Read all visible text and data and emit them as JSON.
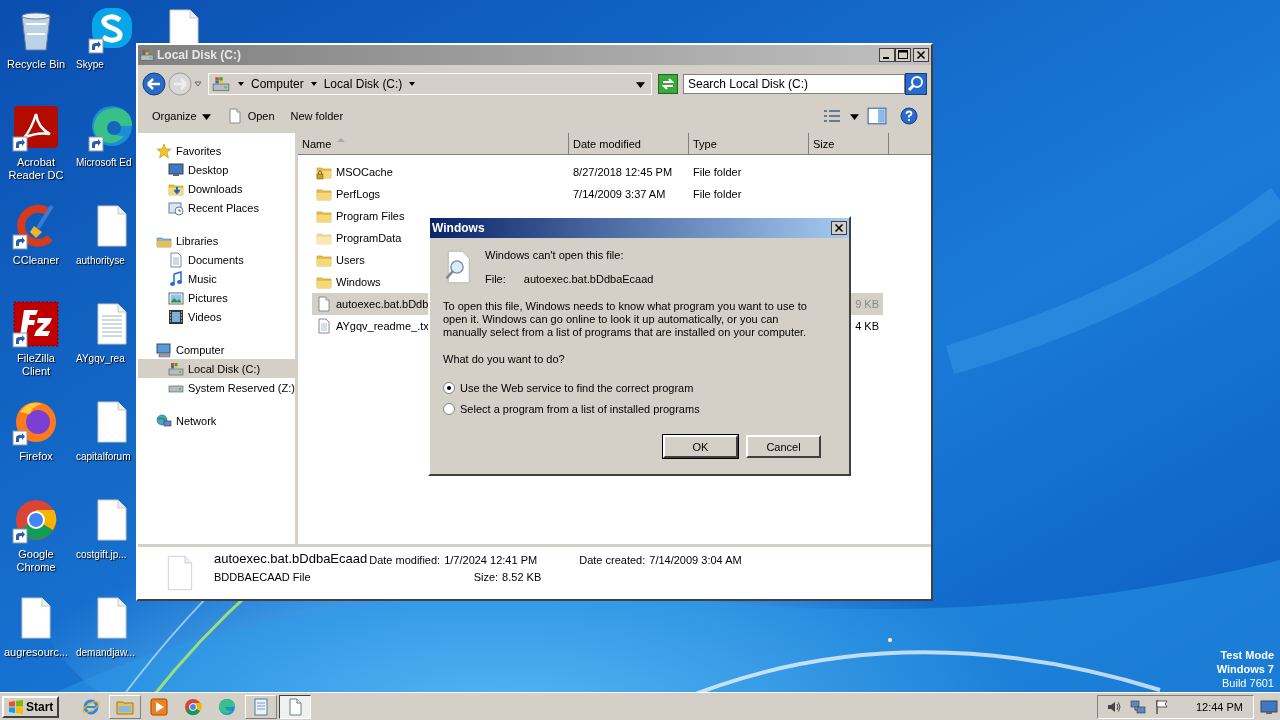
{
  "desktop_icons": [
    {
      "kind": "recycle",
      "label": "Recycle Bin",
      "shortcut": false
    },
    {
      "kind": "acrobat",
      "label": "Acrobat Reader DC",
      "shortcut": true
    },
    {
      "kind": "ccleaner",
      "label": "CCleaner",
      "shortcut": true
    },
    {
      "kind": "filezilla",
      "label": "FileZilla Client",
      "shortcut": true
    },
    {
      "kind": "firefox",
      "label": "Firefox",
      "shortcut": true
    },
    {
      "kind": "chrome",
      "label": "Google Chrome",
      "shortcut": true
    },
    {
      "kind": "file",
      "label": "augresourc...",
      "shortcut": false
    },
    {
      "kind": "skype",
      "label": "Skype",
      "shortcut": true
    },
    {
      "kind": "edge",
      "label": "Microsoft Ed",
      "shortcut": true
    },
    {
      "kind": "file",
      "label": "authorityse",
      "shortcut": false
    },
    {
      "kind": "textfile",
      "label": "AYgqv_rea",
      "shortcut": false
    },
    {
      "kind": "file",
      "label": "capitalforum",
      "shortcut": false
    },
    {
      "kind": "file",
      "label": "costgift.jp...",
      "shortcut": false
    },
    {
      "kind": "file",
      "label": "demandjaw...",
      "shortcut": false
    },
    {
      "kind": "file",
      "shortcut": false
    }
  ],
  "explorer": {
    "title": "Local Disk (C:)",
    "breadcrumb": [
      "Computer",
      "Local Disk (C:)"
    ],
    "search": {
      "placeholder": "Search Local Disk (C:)"
    },
    "toolbar": [
      {
        "kind": "menu",
        "label": "Organize"
      },
      {
        "kind": "open",
        "label": "Open"
      },
      {
        "kind": "plain",
        "label": "New folder"
      }
    ],
    "nav": [
      {
        "kind": "favorites",
        "label": "Favorites",
        "selected": false,
        "children": [
          {
            "kind": "desktop",
            "label": "Desktop",
            "selected": false
          },
          {
            "kind": "downloads",
            "label": "Downloads",
            "selected": false
          },
          {
            "kind": "recent",
            "label": "Recent Places",
            "selected": false
          }
        ]
      },
      {
        "kind": "libraries",
        "label": "Libraries",
        "selected": false,
        "children": [
          {
            "kind": "documents",
            "label": "Documents",
            "selected": false
          },
          {
            "kind": "music",
            "label": "Music",
            "selected": false
          },
          {
            "kind": "pictures",
            "label": "Pictures",
            "selected": false
          },
          {
            "kind": "videos",
            "label": "Videos",
            "selected": false
          }
        ]
      },
      {
        "kind": "computer",
        "label": "Computer",
        "selected": false,
        "children": [
          {
            "kind": "drive",
            "label": "Local Disk (C:)",
            "selected": true
          },
          {
            "kind": "drive-small",
            "label": "System Reserved (Z:)",
            "selected": false
          }
        ]
      },
      {
        "kind": "network",
        "label": "Network",
        "selected": false
      }
    ],
    "columns": [
      {
        "label": "Name",
        "sorted": true
      },
      {
        "label": "Date modified",
        "sorted": false
      },
      {
        "label": "Type",
        "sorted": false
      },
      {
        "label": "Size",
        "sorted": false
      }
    ],
    "rows": [
      {
        "kind": "locked-folder",
        "name": "MSOCache",
        "date": "8/27/2018 12:45 PM",
        "type": "File folder",
        "selected": false
      },
      {
        "kind": "folder",
        "name": "PerfLogs",
        "date": "7/14/2009 3:37 AM",
        "type": "File folder",
        "selected": false
      },
      {
        "kind": "folder",
        "name": "Program Files",
        "selected": false
      },
      {
        "kind": "folder-faded",
        "name": "ProgramData",
        "selected": false
      },
      {
        "kind": "folder",
        "name": "Users",
        "selected": false
      },
      {
        "kind": "folder",
        "name": "Windows",
        "selected": false
      },
      {
        "kind": "file",
        "name": "autoexec.bat.bDdb",
        "size": "9 KB",
        "selected": true
      },
      {
        "kind": "textfile",
        "name": "AYgqv_readme_.tx",
        "size": "4 KB",
        "selected": false
      }
    ],
    "details": {
      "name": "autoexec.bat.bDdbaEcaad",
      "type": "BDDBAECAAD File",
      "fields": [
        {
          "label": "Date modified:",
          "value": "1/7/2024 12:41 PM"
        },
        {
          "label": "Date created:",
          "value": "7/14/2009 3:04 AM"
        },
        {
          "label": "Size:",
          "value": "8.52 KB"
        }
      ]
    }
  },
  "dialog": {
    "title": "Windows",
    "heading": "Windows can't open this file:",
    "file_label": "File:",
    "file_name": "autoexec.bat.bDdbaEcaad",
    "message": "To open this file, Windows needs to know what program you want to use to open it. Windows can go online to look it up automatically, or you can manually select from a list of programs that are installed on your computer.",
    "question": "What do you want to do?",
    "options": [
      {
        "label": "Use the Web service to find the correct program",
        "selected": true
      },
      {
        "label": "Select a program from a list of installed programs",
        "selected": false
      }
    ],
    "buttons": [
      {
        "label": "OK",
        "default": true
      },
      {
        "label": "Cancel",
        "default": false
      }
    ]
  },
  "os_notice": [
    "Test Mode",
    "Windows 7",
    "Build 7601"
  ],
  "taskbar": {
    "start": "Start",
    "apps": [
      {
        "kind": "ie",
        "running": false,
        "selected": false
      },
      {
        "kind": "explorer",
        "running": true,
        "selected": false
      },
      {
        "kind": "media",
        "running": false,
        "selected": false
      },
      {
        "kind": "chrome",
        "running": false,
        "selected": false
      },
      {
        "kind": "edge",
        "running": false,
        "selected": false
      },
      {
        "kind": "notepad",
        "running": true,
        "selected": false
      },
      {
        "kind": "file",
        "running": true,
        "selected": true
      }
    ],
    "clock": "12:44 PM"
  }
}
